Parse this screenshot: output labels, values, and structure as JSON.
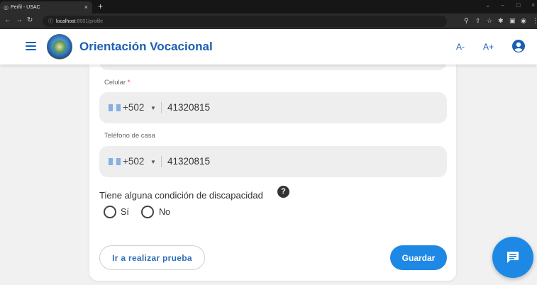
{
  "browser": {
    "tab_title": "Perfil - USAC",
    "tab_close": "×",
    "new_tab": "+",
    "url_host": "localhost",
    "url_path": ":8001/profile",
    "win_min": "–",
    "win_max": "□",
    "win_close": "×"
  },
  "header": {
    "title": "Orientación Vocacional",
    "font_decrease": "A-",
    "font_increase": "A+"
  },
  "form": {
    "celular": {
      "label": "Celular",
      "required_mark": "*",
      "country_code": "+502",
      "number": "41320815"
    },
    "telefono_casa": {
      "label": "Teléfono de casa",
      "country_code": "+502",
      "number": "41320815"
    },
    "discapacidad": {
      "question": "Tiene alguna condición de discapacidad",
      "help": "?",
      "options": [
        "Sí",
        "No"
      ],
      "selected": null
    }
  },
  "actions": {
    "take_test_label": "Ir a realizar prueba",
    "save_label": "Guardar"
  },
  "colors": {
    "primary": "#1e88e5",
    "brand_text": "#1a5fb4",
    "field_bg": "#eeeeee",
    "required": "#e53935"
  },
  "icons": {
    "menu": "hamburger-menu-icon",
    "account": "account-circle-icon",
    "help": "help-circle-icon",
    "chat": "chat-icon",
    "flag": "guatemala-flag-icon"
  }
}
